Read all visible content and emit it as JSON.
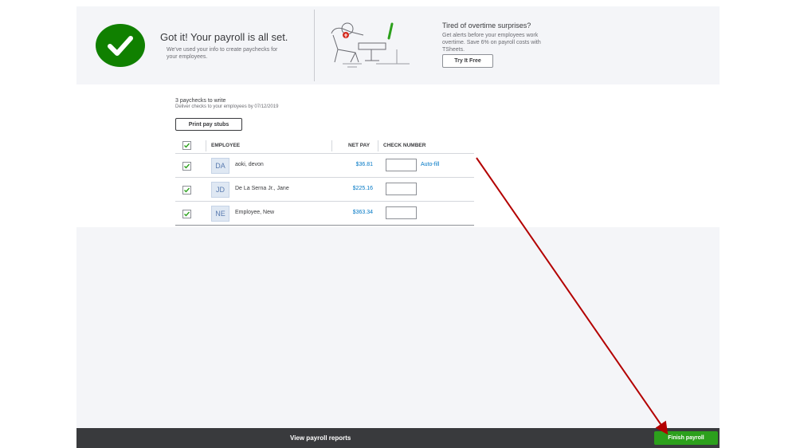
{
  "banner": {
    "title": "Got it! Your payroll is all set.",
    "subtitle": "We've used your info to create paychecks for your employees.",
    "promo_title": "Tired of overtime surprises?",
    "promo_text": "Get alerts before your employees work overtime. Save 6% on payroll costs with TSheets.",
    "promo_button": "Try It Free"
  },
  "summary": {
    "count_text": "3 paychecks to write",
    "deliver_text": "Deliver checks to your employees by 07/12/2019",
    "print_button": "Print pay stubs"
  },
  "table": {
    "headers": {
      "employee": "EMPLOYEE",
      "net_pay": "NET PAY",
      "check_number": "CHECK NUMBER"
    },
    "select_all_checked": true,
    "rows": [
      {
        "initials": "DA",
        "name": "aoki, devon",
        "net_pay": "$36.81",
        "check_number": "",
        "checked": true,
        "autofill": "Auto-fill"
      },
      {
        "initials": "JD",
        "name": "De La Serna Jr., Jane",
        "net_pay": "$225.16",
        "check_number": "",
        "checked": true
      },
      {
        "initials": "NE",
        "name": "Employee, New",
        "net_pay": "$363.34",
        "check_number": "",
        "checked": true
      }
    ]
  },
  "footer": {
    "reports_link": "View payroll reports",
    "finish_button": "Finish payroll"
  },
  "colors": {
    "success_green": "#108000",
    "button_green": "#2ca01c",
    "link_blue": "#0077c5",
    "footer_dark": "#393a3d",
    "annotation_red": "#b30000"
  },
  "icons": {
    "success": "checkmark-circle-icon",
    "checkbox": "check-icon",
    "illustration": "person-relaxing-illustration"
  }
}
